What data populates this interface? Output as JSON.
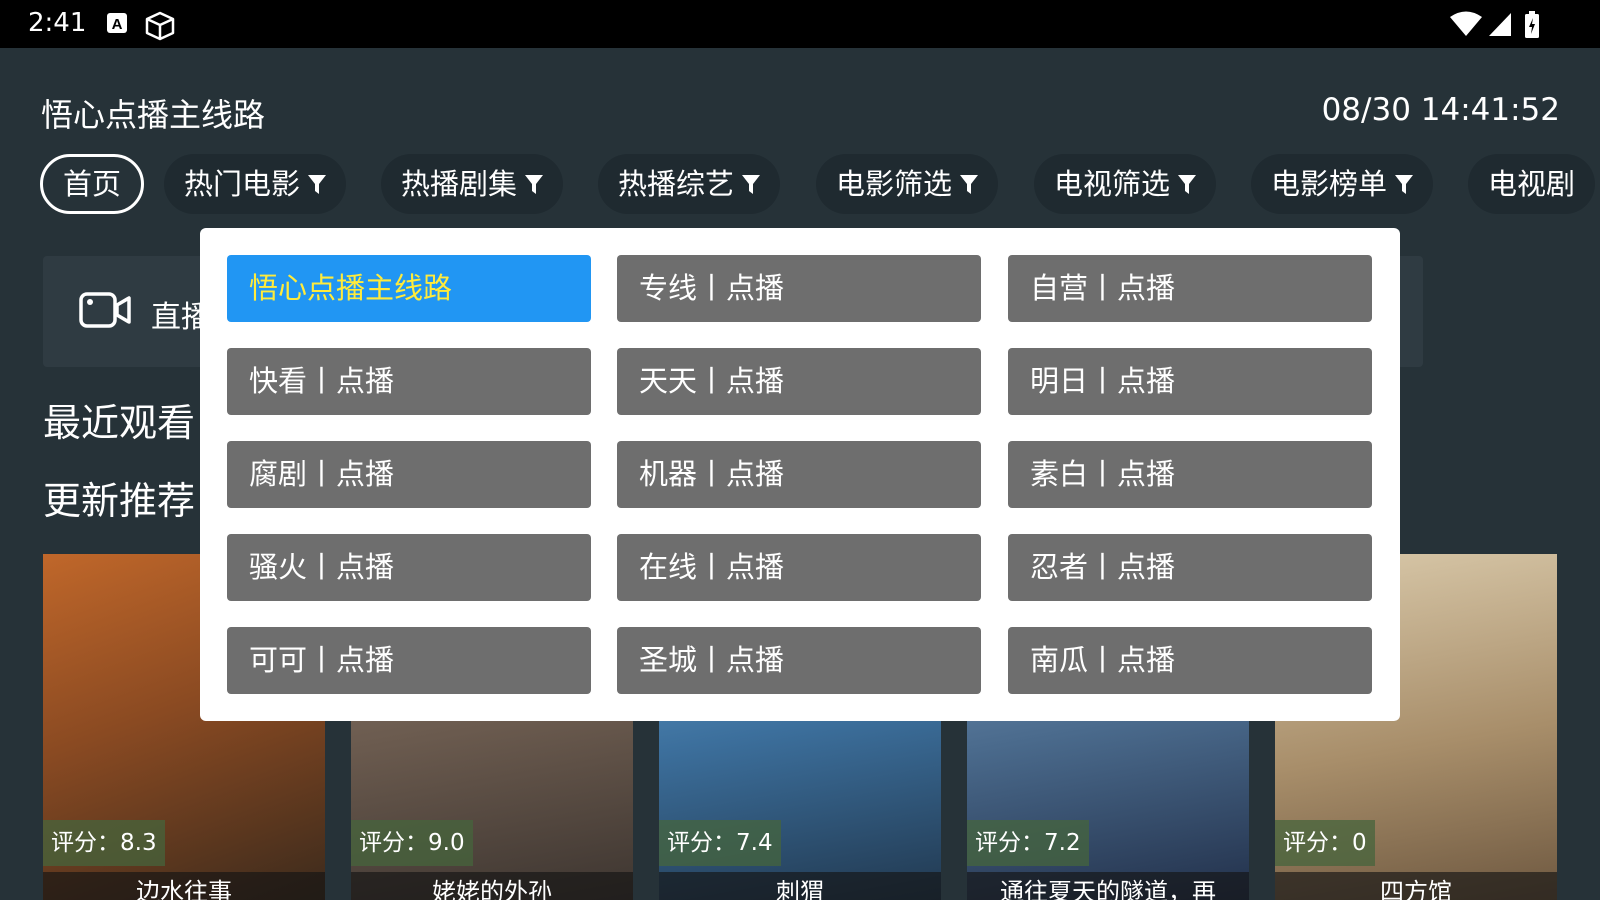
{
  "statusbar": {
    "time": "2:41",
    "icons": [
      "a-notification-icon",
      "cube-icon",
      "wifi-icon",
      "signal-icon",
      "battery-icon"
    ]
  },
  "header": {
    "title": "悟心点播主线路",
    "clock": "08/30 14:41:52"
  },
  "tabs": [
    {
      "label": "首页",
      "active": true
    },
    {
      "label": "热门电影",
      "filter": true
    },
    {
      "label": "热播剧集",
      "filter": true
    },
    {
      "label": "热播综艺",
      "filter": true
    },
    {
      "label": "电影筛选",
      "filter": true
    },
    {
      "label": "电视筛选",
      "filter": true
    },
    {
      "label": "电影榜单",
      "filter": true
    },
    {
      "label": "电视剧"
    }
  ],
  "live": {
    "label": "直播"
  },
  "sections": {
    "recent": "最近观看",
    "updates": "更新推荐"
  },
  "posters": [
    {
      "rating": "评分：8.3",
      "name": "边水往事",
      "colors": [
        "#c0672a",
        "#3b2a1c"
      ]
    },
    {
      "rating": "评分：9.0",
      "name": "姥姥的外孙",
      "colors": [
        "#7d6a5c",
        "#3d3530"
      ]
    },
    {
      "rating": "评分：7.4",
      "name": "刺猬",
      "colors": [
        "#4f8fc4",
        "#21384f"
      ]
    },
    {
      "rating": "评分：7.2",
      "name": "通往夏天的隧道，再",
      "colors": [
        "#5b7fa8",
        "#22304a"
      ]
    },
    {
      "rating": "评分：0",
      "name": "四方馆",
      "colors": [
        "#c9b89a",
        "#6e5840"
      ]
    }
  ],
  "dropdown": {
    "sources": [
      {
        "label": "悟心点播主线路",
        "selected": true
      },
      {
        "label": "专线丨点播"
      },
      {
        "label": "自营丨点播"
      },
      {
        "label": "快看丨点播"
      },
      {
        "label": "天天丨点播"
      },
      {
        "label": "明日丨点播"
      },
      {
        "label": "腐剧丨点播"
      },
      {
        "label": "机器丨点播"
      },
      {
        "label": "素白丨点播"
      },
      {
        "label": "骚火丨点播"
      },
      {
        "label": "在线丨点播"
      },
      {
        "label": "忍者丨点播"
      },
      {
        "label": "可可丨点播"
      },
      {
        "label": "圣城丨点播"
      },
      {
        "label": "南瓜丨点播"
      }
    ]
  }
}
